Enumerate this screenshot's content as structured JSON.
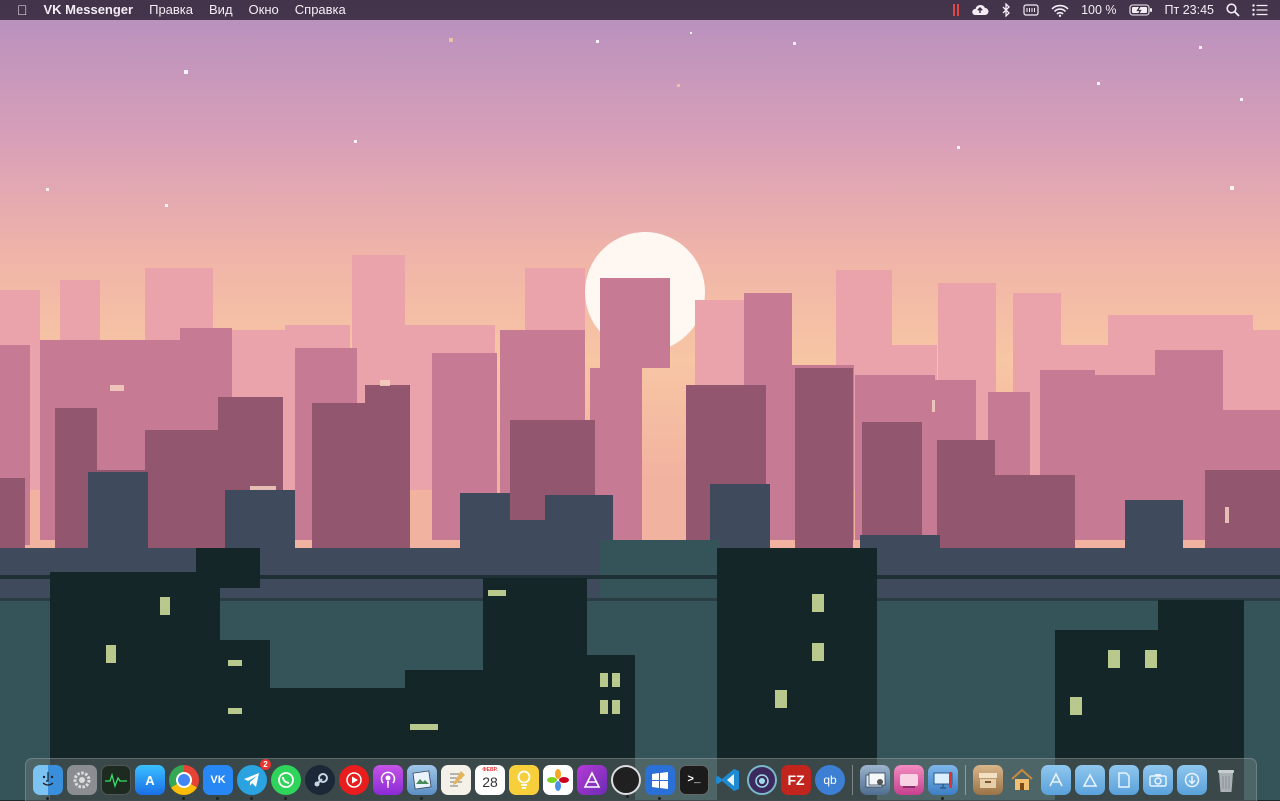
{
  "menubar": {
    "apple_glyph": "",
    "app_name": "VK Messenger",
    "menus": [
      "Правка",
      "Вид",
      "Окно",
      "Справка"
    ],
    "status": {
      "battery_percent": "100 %",
      "clock": "Пт 23:45"
    }
  },
  "dock": {
    "apps": [
      {
        "name": "Finder",
        "icon": "finder-icon",
        "running": true
      },
      {
        "name": "System Preferences",
        "icon": "gear-icon",
        "running": false
      },
      {
        "name": "Activity Monitor",
        "icon": "activity-monitor-icon",
        "running": false
      },
      {
        "name": "App Store",
        "icon": "app-store-icon",
        "label": "A",
        "running": false
      },
      {
        "name": "Google Chrome",
        "icon": "chrome-icon",
        "running": true
      },
      {
        "name": "VK Messenger",
        "icon": "vk-icon",
        "label": "VK",
        "running": true
      },
      {
        "name": "Telegram",
        "icon": "telegram-icon",
        "badge": "2",
        "running": true
      },
      {
        "name": "WhatsApp",
        "icon": "whatsapp-icon",
        "running": true
      },
      {
        "name": "Steam",
        "icon": "steam-icon",
        "running": false
      },
      {
        "name": "YouTube Music",
        "icon": "youtube-music-icon",
        "running": false
      },
      {
        "name": "Podcasts",
        "icon": "podcasts-icon",
        "running": false
      },
      {
        "name": "Preview",
        "icon": "preview-icon",
        "running": true
      },
      {
        "name": "TextEdit",
        "icon": "textedit-icon",
        "running": false
      },
      {
        "name": "Calendar",
        "icon": "calendar-icon",
        "cal_month": "ФЕВР.",
        "cal_day": "28",
        "running": false
      },
      {
        "name": "Tips",
        "icon": "lightbulb-icon",
        "running": false
      },
      {
        "name": "Photos",
        "icon": "photos-icon",
        "running": false
      },
      {
        "name": "Affinity Designer",
        "icon": "affinity-icon",
        "running": false
      },
      {
        "name": "Camo",
        "icon": "circle-icon",
        "running": true
      },
      {
        "name": "Microsoft Remote Desktop",
        "icon": "windows-icon",
        "running": true
      },
      {
        "name": "Terminal",
        "icon": "terminal-icon",
        "label": ">_",
        "running": false
      },
      {
        "name": "Visual Studio Code",
        "icon": "vscode-icon",
        "running": false
      },
      {
        "name": "Tor Browser",
        "icon": "tor-icon",
        "running": false
      },
      {
        "name": "FileZilla",
        "icon": "filezilla-icon",
        "label": "FZ",
        "running": false
      },
      {
        "name": "qBittorrent",
        "icon": "qbittorrent-icon",
        "label": "qb",
        "running": false
      }
    ],
    "extras": [
      {
        "name": "Preview Files",
        "icon": "photo-stack-icon"
      },
      {
        "name": "CleanMyMac",
        "icon": "cleanmymac-icon"
      },
      {
        "name": "Desktop",
        "icon": "desktop-monitor-icon"
      }
    ],
    "folders": [
      {
        "name": "Library",
        "icon": "archive-icon"
      },
      {
        "name": "Home",
        "icon": "home-icon"
      },
      {
        "name": "Applications",
        "icon": "applications-folder-icon"
      },
      {
        "name": "Documents",
        "icon": "documents-folder-icon"
      },
      {
        "name": "Files",
        "icon": "file-folder-icon"
      },
      {
        "name": "Screenshots",
        "icon": "camera-folder-icon"
      },
      {
        "name": "Downloads",
        "icon": "downloads-folder-icon"
      }
    ],
    "trash": {
      "name": "Trash",
      "icon": "trash-icon"
    }
  },
  "colors": {
    "sky_top": "#b992bd",
    "sky_mid": "#f2b9a3",
    "sky_low": "#f7c5a3",
    "sun": "#fff6f0",
    "far_buildings": "#e8a0a8",
    "mid_buildings": "#c4788f",
    "near_buildings": "#8f5270",
    "dark_layer": "#3b4a57",
    "foreground": "#16272a",
    "window_light": "#b8c98f"
  }
}
